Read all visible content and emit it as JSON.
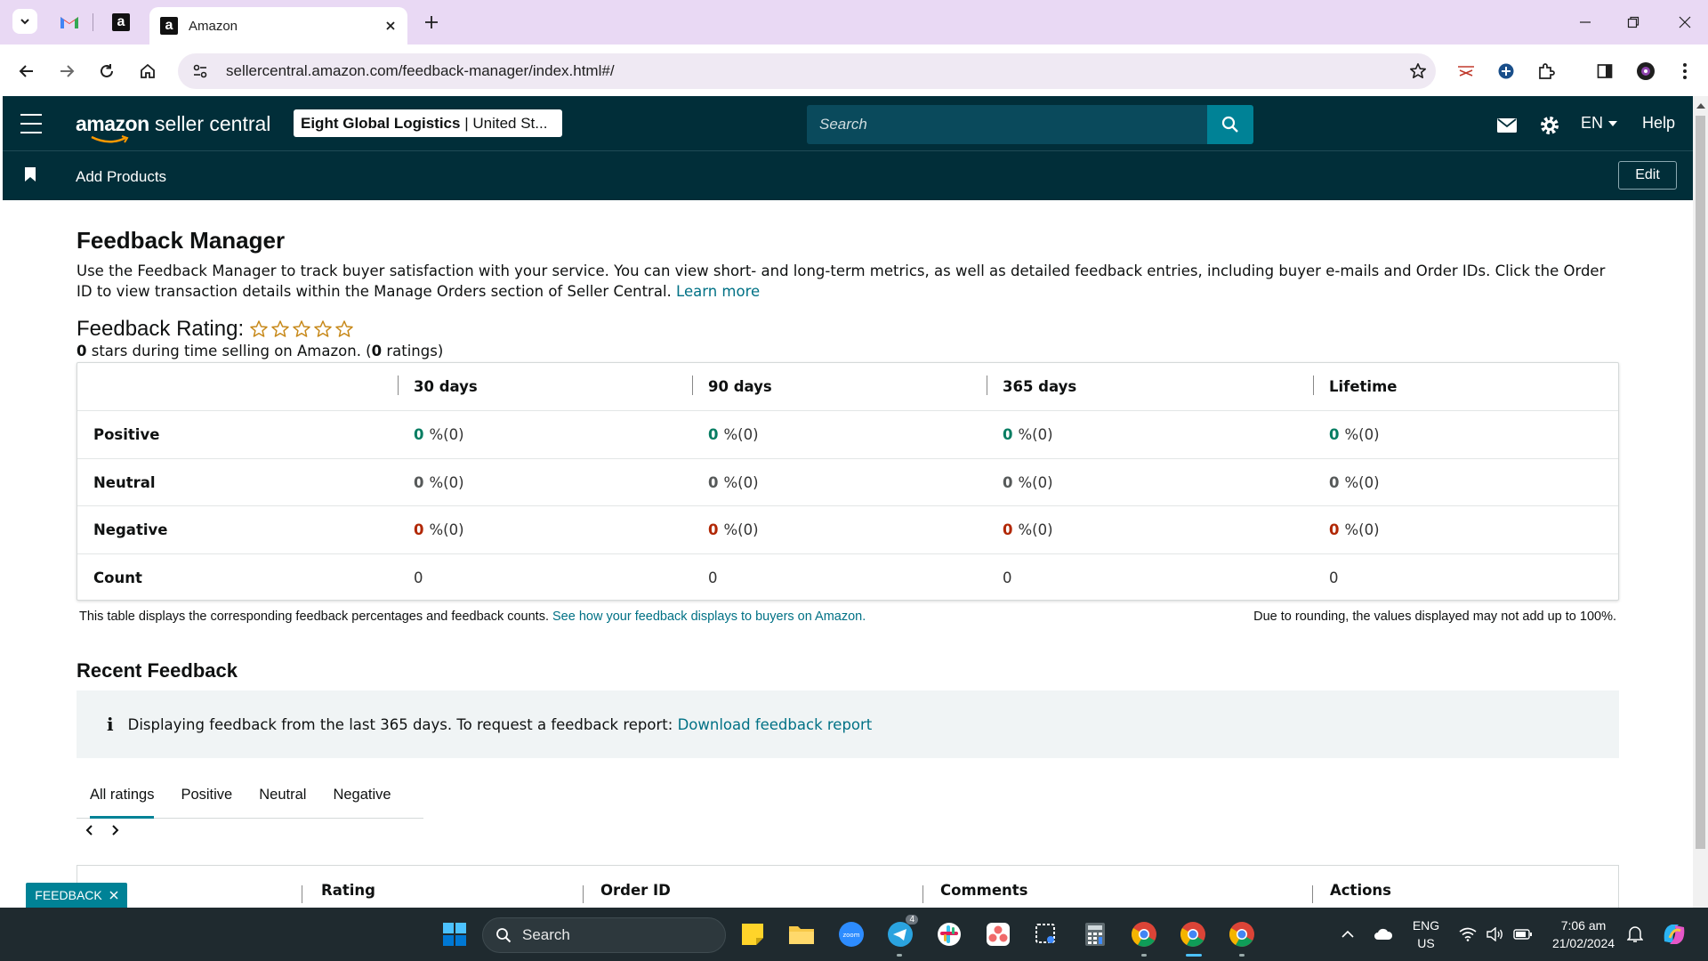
{
  "browser": {
    "tab_title": "Amazon",
    "url": "sellercentral.amazon.com/feedback-manager/index.html#/"
  },
  "header": {
    "logo_text": "seller central",
    "logo_brand": "amazon",
    "account_name": "Eight Global Logistics",
    "account_region": "United St...",
    "search_placeholder": "Search",
    "language": "EN",
    "help": "Help",
    "add_products": "Add Products",
    "edit": "Edit"
  },
  "page": {
    "title": "Feedback Manager",
    "intro": "Use the Feedback Manager to track buyer satisfaction with your service. You can view short- and long-term metrics, as well as detailed feedback entries, including buyer e-mails and Order IDs. Click the Order ID to view transaction details within the Manage Orders section of Seller Central.",
    "learn_more": "Learn more",
    "rating_label": "Feedback Rating:",
    "rating_stars": 0,
    "rating_sub_stars": "0",
    "rating_sub_text_1": " stars during time selling on Amazon. (",
    "rating_sub_count": "0",
    "rating_sub_text_2": " ratings)"
  },
  "feedback_table": {
    "columns": [
      "30 days",
      "90 days",
      "365 days",
      "Lifetime"
    ],
    "rows": [
      {
        "label": "Positive",
        "values": [
          "0",
          "0",
          "0",
          "0"
        ],
        "suffix": "%(0)"
      },
      {
        "label": "Neutral",
        "values": [
          "0",
          "0",
          "0",
          "0"
        ],
        "suffix": "%(0)"
      },
      {
        "label": "Negative",
        "values": [
          "0",
          "0",
          "0",
          "0"
        ],
        "suffix": "%(0)"
      },
      {
        "label": "Count",
        "values": [
          "0",
          "0",
          "0",
          "0"
        ]
      }
    ],
    "note_left": "This table displays the corresponding feedback percentages and feedback counts.",
    "note_link": "See how your feedback displays to buyers on Amazon.",
    "note_right": "Due to rounding, the values displayed may not add up to 100%."
  },
  "recent": {
    "title": "Recent Feedback",
    "info_text": "Displaying feedback from the last 365 days. To request a feedback report:",
    "info_link": "Download feedback report",
    "tabs": [
      "All ratings",
      "Positive",
      "Neutral",
      "Negative"
    ],
    "list_columns": [
      "Rating",
      "Order ID",
      "Comments",
      "Actions"
    ],
    "feedback_tab_label": "FEEDBACK"
  },
  "taskbar": {
    "search": "Search",
    "lang_top": "ENG",
    "lang_bottom": "US",
    "time": "7:06 am",
    "date": "21/02/2024",
    "telegram_badge": "4"
  },
  "colors": {
    "sc_header": "#012e39",
    "accent": "#008296",
    "link": "#007185",
    "positive": "#067d62",
    "negative": "#b12704",
    "star": "#c7891a"
  }
}
